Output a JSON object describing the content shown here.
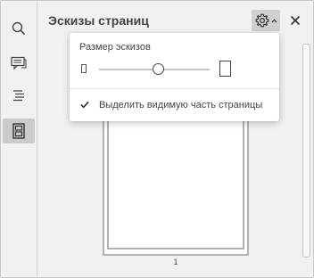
{
  "panel": {
    "title": "Эскизы страниц",
    "settings_icon": "gear-icon",
    "close_icon": "close-icon"
  },
  "toolbar": {
    "items": [
      {
        "icon": "search-icon",
        "active": false
      },
      {
        "icon": "comments-icon",
        "active": false
      },
      {
        "icon": "headings-icon",
        "active": false
      },
      {
        "icon": "thumbnails-icon",
        "active": true
      }
    ]
  },
  "popup": {
    "size_label": "Размер эскизов",
    "slider_value": 0.54,
    "option_label": "Выделить видимую часть страницы",
    "option_checked": true
  },
  "thumbnails": [
    {
      "page_number": "1"
    }
  ],
  "colors": {
    "background": "#f1f1f1",
    "active_toolbar": "#cbcbcb",
    "popup_bg": "#ffffff"
  }
}
